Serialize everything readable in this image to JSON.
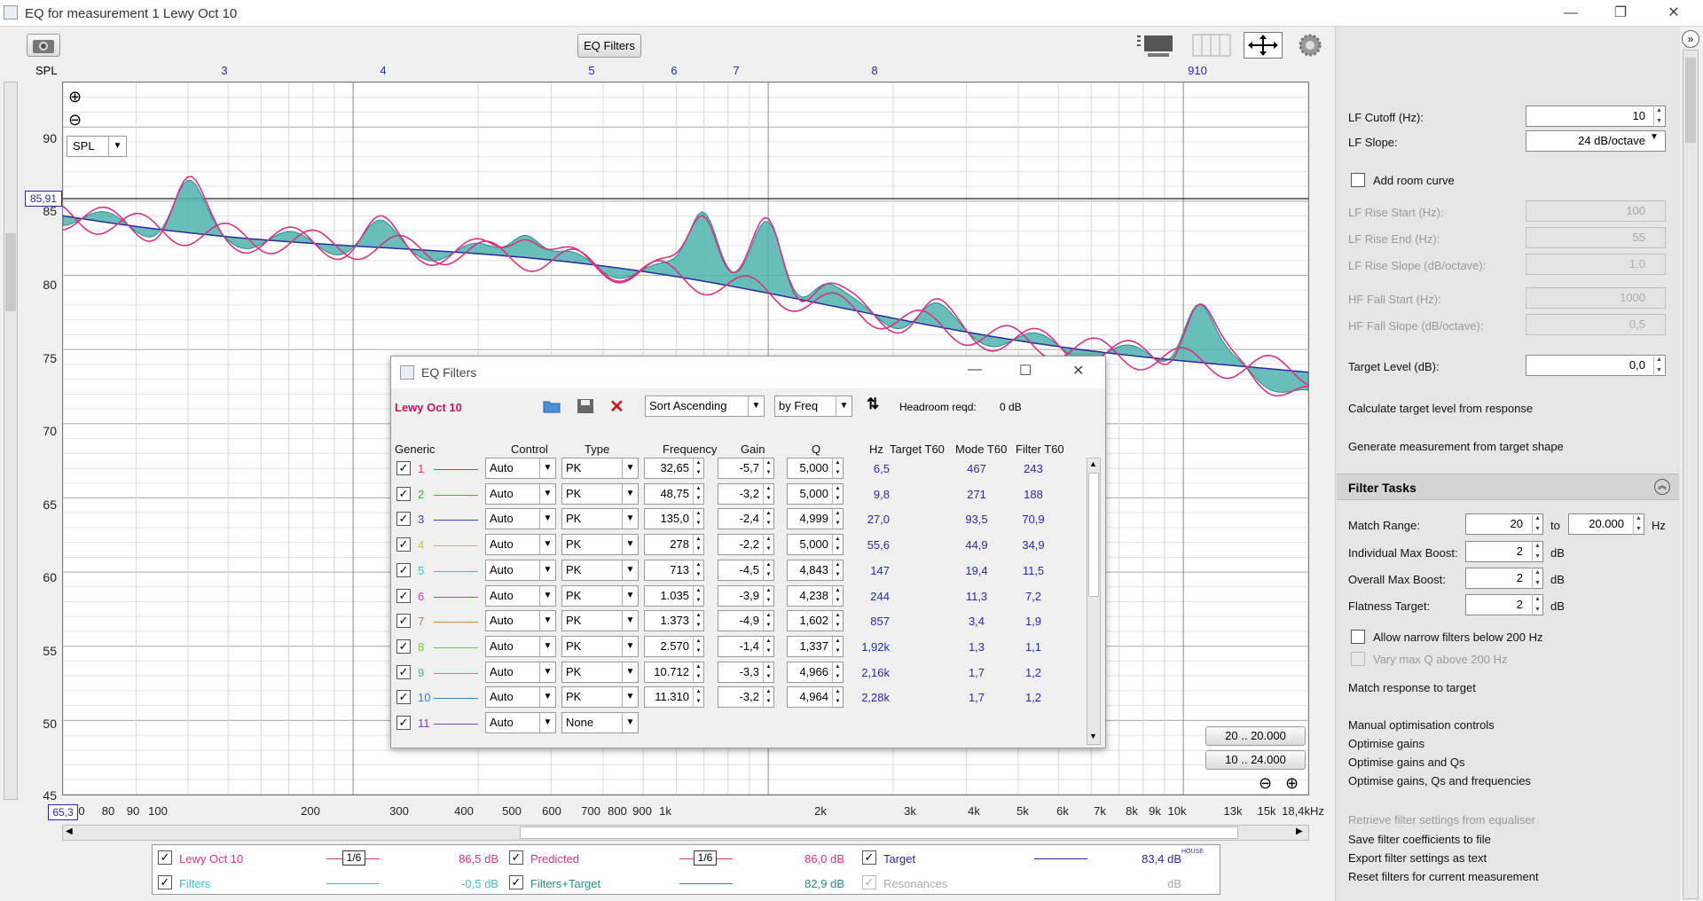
{
  "window": {
    "title": "EQ for measurement 1 Lewy Oct 10",
    "min": "—",
    "max": "❐",
    "close": "✕"
  },
  "toolbar": {
    "eq_filters": "EQ Filters",
    "camera": "camera-icon"
  },
  "graph": {
    "spl_label": "SPL",
    "spl_select": "SPL",
    "level_marker": "85,91",
    "x_marker": "65,3",
    "y_ticks": [
      "90",
      "85",
      "80",
      "75",
      "70",
      "65",
      "60",
      "55",
      "50",
      "45"
    ],
    "x_ticks": [
      "0",
      "80",
      "90",
      "100",
      "200",
      "300",
      "400",
      "500",
      "600",
      "700",
      "800",
      "900",
      "1k",
      "2k",
      "3k",
      "4k",
      "5k",
      "6k",
      "7k",
      "8k",
      "9k",
      "10k",
      "13k",
      "15k",
      "18,4kHz"
    ],
    "top_ticks": [
      "3",
      "4",
      "5",
      "6",
      "7",
      "8",
      "910"
    ],
    "range1": "20 .. 20.000",
    "range2": "10 .. 24.000"
  },
  "eq": {
    "title": "EQ Filters",
    "measurement": "Lewy Oct 10",
    "sort": "Sort Ascending",
    "by": "by Freq",
    "headroom_label": "Headroom reqd:",
    "headroom_value": "0 dB",
    "cols": {
      "generic": "Generic",
      "control": "Control",
      "type": "Type",
      "freq": "Frequency",
      "gain": "Gain",
      "q": "Q",
      "hz": "Hz",
      "tt60": "Target T60",
      "mt60": "Mode T60",
      "ft60": "Filter T60"
    },
    "rows": [
      {
        "n": "1",
        "color": "#d04040",
        "ctrl": "Auto",
        "type": "PK",
        "freq": "32,65",
        "gain": "-5,7",
        "q": "5,000",
        "hz": "6,5",
        "mt60": "467",
        "ft60": "243"
      },
      {
        "n": "2",
        "color": "#40b040",
        "ctrl": "Auto",
        "type": "PK",
        "freq": "48,75",
        "gain": "-3,2",
        "q": "5,000",
        "hz": "9,8",
        "mt60": "271",
        "ft60": "188"
      },
      {
        "n": "3",
        "color": "#4040c0",
        "ctrl": "Auto",
        "type": "PK",
        "freq": "135,0",
        "gain": "-2,4",
        "q": "4,999",
        "hz": "27,0",
        "mt60": "93,5",
        "ft60": "70,9"
      },
      {
        "n": "4",
        "color": "#c8c040",
        "ctrl": "Auto",
        "type": "PK",
        "freq": "278",
        "gain": "-2,2",
        "q": "5,000",
        "hz": "55,6",
        "mt60": "44,9",
        "ft60": "34,9"
      },
      {
        "n": "5",
        "color": "#40c0c0",
        "ctrl": "Auto",
        "type": "PK",
        "freq": "713",
        "gain": "-4,5",
        "q": "4,843",
        "hz": "147",
        "mt60": "19,4",
        "ft60": "11,5"
      },
      {
        "n": "6",
        "color": "#c040c0",
        "ctrl": "Auto",
        "type": "PK",
        "freq": "1.035",
        "gain": "-3,9",
        "q": "4,238",
        "hz": "244",
        "mt60": "11,3",
        "ft60": "7,2"
      },
      {
        "n": "7",
        "color": "#d08040",
        "ctrl": "Auto",
        "type": "PK",
        "freq": "1.373",
        "gain": "-4,9",
        "q": "1,602",
        "hz": "857",
        "mt60": "3,4",
        "ft60": "1,9"
      },
      {
        "n": "8",
        "color": "#80c040",
        "ctrl": "Auto",
        "type": "PK",
        "freq": "2.570",
        "gain": "-1,4",
        "q": "1,337",
        "hz": "1,92k",
        "mt60": "1,3",
        "ft60": "1,1"
      },
      {
        "n": "9",
        "color": "#40c080",
        "ctrl": "Auto",
        "type": "PK",
        "freq": "10.712",
        "gain": "-3,3",
        "q": "4,966",
        "hz": "2,16k",
        "mt60": "1,7",
        "ft60": "1,2"
      },
      {
        "n": "10",
        "color": "#4080c0",
        "ctrl": "Auto",
        "type": "PK",
        "freq": "11.310",
        "gain": "-3,2",
        "q": "4,964",
        "hz": "2,28k",
        "mt60": "1,7",
        "ft60": "1,2"
      },
      {
        "n": "11",
        "color": "#8040c0",
        "ctrl": "Auto",
        "type": "None",
        "freq": "",
        "gain": "",
        "q": "",
        "hz": "",
        "mt60": "",
        "ft60": ""
      }
    ]
  },
  "right": {
    "lf_cutoff_label": "LF Cutoff (Hz):",
    "lf_cutoff": "10",
    "lf_slope_label": "LF Slope:",
    "lf_slope": "24 dB/octave",
    "add_room": "Add room curve",
    "lf_rise_start_label": "LF Rise Start (Hz):",
    "lf_rise_start": "100",
    "lf_rise_end_label": "LF Rise End (Hz):",
    "lf_rise_end": "55",
    "lf_rise_slope_label": "LF Rise Slope (dB/octave):",
    "lf_rise_slope": "1,0",
    "hf_fall_start_label": "HF Fall Start (Hz):",
    "hf_fall_start": "1000",
    "hf_fall_slope_label": "HF Fall Slope (dB/octave):",
    "hf_fall_slope": "0,5",
    "target_level_label": "Target Level (dB):",
    "target_level": "0,0",
    "calc_target": "Calculate target level from response",
    "gen_meas": "Generate measurement from target shape",
    "filter_tasks": "Filter Tasks",
    "match_range_label": "Match Range:",
    "match_from": "20",
    "to": "to",
    "match_to": "20.000",
    "hz": "Hz",
    "ind_boost_label": "Individual Max Boost:",
    "ind_boost": "2",
    "overall_boost_label": "Overall Max Boost:",
    "overall_boost": "2",
    "flat_label": "Flatness Target:",
    "flat": "2",
    "db": "dB",
    "narrow": "Allow narrow filters below 200 Hz",
    "varyq": "Vary max Q above 200 Hz",
    "match_resp": "Match response to target",
    "manual": "Manual optimisation controls",
    "opt_g": "Optimise gains",
    "opt_gq": "Optimise gains and Qs",
    "opt_gqf": "Optimise gains, Qs and frequencies",
    "retrieve": "Retrieve filter settings from equaliser",
    "save_coef": "Save filter coefficients to file",
    "export": "Export filter settings as text",
    "reset": "Reset filters for current measurement"
  },
  "legend": {
    "m1": "Lewy Oct 10",
    "m1_smooth": "1/6",
    "m1_val": "86,5 dB",
    "pred": "Predicted",
    "pred_smooth": "1/6",
    "pred_val": "86,0 dB",
    "target": "Target",
    "target_val": "83,4 dB",
    "target_sup": "HOUSE",
    "filters": "Filters",
    "filters_val": "-0,5 dB",
    "ft": "Filters+Target",
    "ft_val": "82,9 dB",
    "res": "Resonances",
    "res_val": "dB"
  },
  "colors": {
    "measurement": "#d63384",
    "target": "#2b2b9e",
    "fill": "#4fb3b0",
    "filters": "#40c0c0"
  }
}
